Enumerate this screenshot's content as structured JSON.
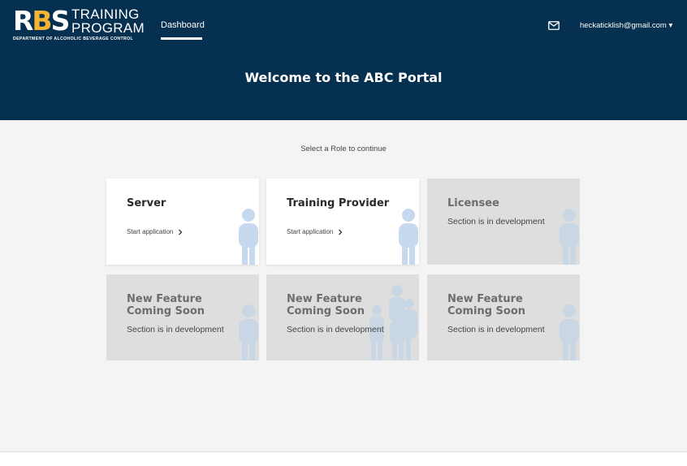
{
  "header": {
    "logo": {
      "mark_r": "R",
      "mark_b": "B",
      "mark_s": "S",
      "line1": "TRAINING",
      "line2": "PROGRAM",
      "subtitle": "DEPARTMENT OF ALCOHOLIC BEVERAGE CONTROL"
    },
    "nav": {
      "dashboard": "Dashboard"
    },
    "account": {
      "email": "heckaticklish@gmail.com",
      "caret": "▾"
    },
    "welcome": "Welcome to the ABC Portal"
  },
  "main": {
    "prompt": "Select a Role to continue",
    "cards": [
      {
        "title": "Server",
        "link": "Start application"
      },
      {
        "title": "Training Provider",
        "link": "Start application"
      },
      {
        "title": "Licensee",
        "status": "Section is in development"
      },
      {
        "title": "New Feature Coming Soon",
        "status": "Section is in development"
      },
      {
        "title": "New Feature Coming Soon",
        "status": "Section is in development"
      },
      {
        "title": "New Feature Coming Soon",
        "status": "Section is in development"
      }
    ]
  },
  "colors": {
    "header_bg": "#06304f",
    "logo_accent": "#f2b533",
    "page_bg": "#f4f4f4",
    "card_active": "#ffffff",
    "card_disabled": "#dedede",
    "figure_tint": "#c6d9ee"
  },
  "icons": [
    "mail-icon",
    "caret-down-icon",
    "chevron-right-icon",
    "person-icon",
    "people-group-icon"
  ]
}
